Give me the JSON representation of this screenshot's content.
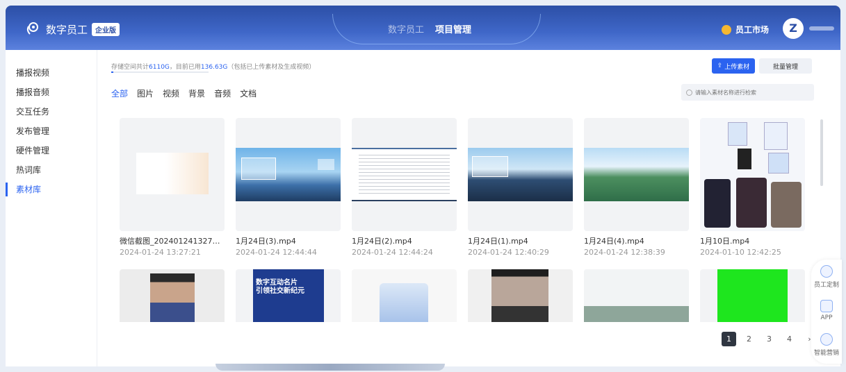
{
  "header": {
    "brand": "数字员工",
    "edition_badge": "企业版",
    "tabs": [
      {
        "label": "数字员工",
        "active": false
      },
      {
        "label": "项目管理",
        "active": true
      }
    ],
    "market_label": "员工市场",
    "avatar_letter": "Z"
  },
  "sidebar": {
    "items": [
      {
        "label": "播报视频",
        "active": false
      },
      {
        "label": "播报音频",
        "active": false
      },
      {
        "label": "交互任务",
        "active": false
      },
      {
        "label": "发布管理",
        "active": false
      },
      {
        "label": "硬件管理",
        "active": false
      },
      {
        "label": "热词库",
        "active": false
      },
      {
        "label": "素材库",
        "active": true
      }
    ]
  },
  "storage": {
    "prefix": "存储空间共计",
    "total": "6110G",
    "mid": "，目前已用",
    "used": "136.63G",
    "suffix": "（包括已上传素材及生成视频）",
    "used_fraction": 0.022
  },
  "toolbar": {
    "upload_label": "上传素材",
    "batch_label": "批量管理"
  },
  "filters": [
    "全部",
    "图片",
    "视频",
    "背景",
    "音频",
    "文档"
  ],
  "search": {
    "placeholder": "请输入素材名称进行检索"
  },
  "materials": [
    {
      "name": "微信截图_20240124132703...",
      "date": "2024-01-24 13:27:21"
    },
    {
      "name": "1月24日(3).mp4",
      "date": "2024-01-24 12:44:44"
    },
    {
      "name": "1月24日(2).mp4",
      "date": "2024-01-24 12:44:24"
    },
    {
      "name": "1月24日(1).mp4",
      "date": "2024-01-24 12:40:29"
    },
    {
      "name": "1月24日(4).mp4",
      "date": "2024-01-24 12:38:39"
    },
    {
      "name": "1月10日.mp4",
      "date": "2024-01-10 12:42:25"
    }
  ],
  "second_row_thumbs": {
    "poster_title_1": "数字互动名片",
    "poster_title_2": "引领社交新纪元"
  },
  "pagination": {
    "pages": [
      "1",
      "2",
      "3",
      "4"
    ],
    "current": "1",
    "next": "›"
  },
  "float_panel": {
    "items": [
      {
        "label": "员工定制"
      },
      {
        "label": "APP"
      },
      {
        "label": "智能营销"
      }
    ]
  },
  "colors": {
    "accent": "#2b63f0",
    "header": "#3a5fc0",
    "green_screen": "#1ee61e"
  }
}
